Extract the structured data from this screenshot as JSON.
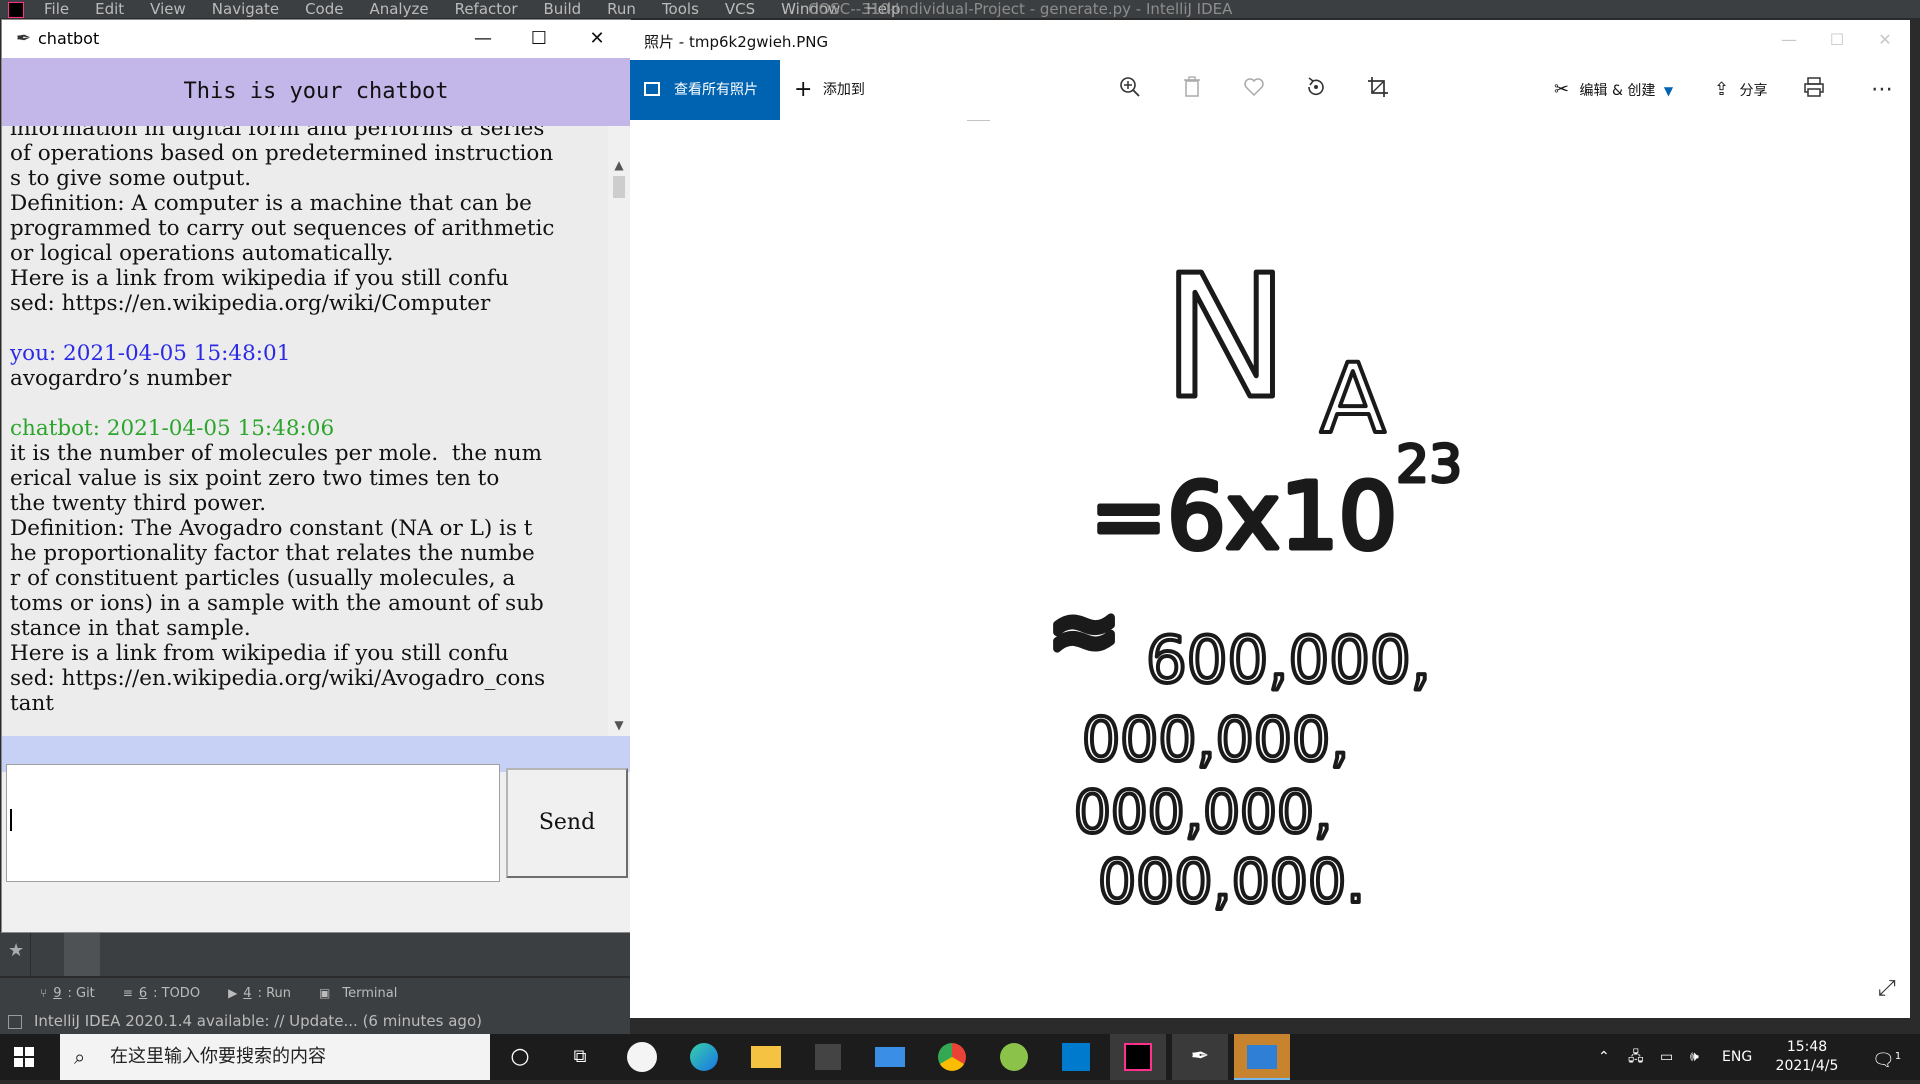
{
  "ide": {
    "menu": [
      "File",
      "Edit",
      "View",
      "Navigate",
      "Code",
      "Analyze",
      "Refactor",
      "Build",
      "Run",
      "Tools",
      "VCS",
      "Window",
      "Help"
    ],
    "title": "COSC--310-Individual-Project - generate.py - IntelliJ IDEA",
    "tool_windows": [
      {
        "key": "9",
        "label": ": Git",
        "icon": "git-branch-icon"
      },
      {
        "key": "6",
        "label": ": TODO",
        "icon": "list-icon"
      },
      {
        "key": "4",
        "label": ": Run",
        "icon": "run-icon"
      },
      {
        "key": "",
        "label": "Terminal",
        "icon": "terminal-icon"
      }
    ],
    "status": "IntelliJ IDEA 2020.1.4 available: // Update... (6 minutes ago)"
  },
  "chatbot": {
    "window_title": "chatbot",
    "header": "This is your chatbot",
    "send_label": "Send",
    "input_value": "",
    "log": [
      {
        "type": "text",
        "text": "information in digital form and performs a series"
      },
      {
        "type": "text",
        "text": "of operations based on predetermined instruction"
      },
      {
        "type": "text",
        "text": "s to give some output."
      },
      {
        "type": "text",
        "text": "Definition: A computer is a machine that can be"
      },
      {
        "type": "text",
        "text": "programmed to carry out sequences of arithmetic"
      },
      {
        "type": "text",
        "text": "or logical operations automatically."
      },
      {
        "type": "text",
        "text": "Here is a link from wikipedia if you still confu"
      },
      {
        "type": "text",
        "text": "sed: https://en.wikipedia.org/wiki/Computer"
      },
      {
        "type": "text",
        "text": " "
      },
      {
        "type": "you",
        "text": "you: 2021-04-05 15:48:01"
      },
      {
        "type": "text",
        "text": "avogardro’s number"
      },
      {
        "type": "text",
        "text": " "
      },
      {
        "type": "bot",
        "text": "chatbot: 2021-04-05 15:48:06"
      },
      {
        "type": "text",
        "text": "it is the number of molecules per mole.  the num"
      },
      {
        "type": "text",
        "text": "erical value is six point zero two times ten to"
      },
      {
        "type": "text",
        "text": "the twenty third power."
      },
      {
        "type": "text",
        "text": "Definition: The Avogadro constant (NA or L) is t"
      },
      {
        "type": "text",
        "text": "he proportionality factor that relates the numbe"
      },
      {
        "type": "text",
        "text": "r of constituent particles (usually molecules, a"
      },
      {
        "type": "text",
        "text": "toms or ions) in a sample with the amount of sub"
      },
      {
        "type": "text",
        "text": "stance in that sample."
      },
      {
        "type": "text",
        "text": "Here is a link from wikipedia if you still confu"
      },
      {
        "type": "text",
        "text": "sed: https://en.wikipedia.org/wiki/Avogadro_cons"
      },
      {
        "type": "text",
        "text": "tant"
      }
    ]
  },
  "photos": {
    "window_title": "照片 - tmp6k2gwieh.PNG",
    "view_all": "查看所有照片",
    "add_to": "添加到",
    "edit_create": "编辑 & 创建",
    "share": "分享",
    "image_text": {
      "symbol": "N",
      "subscript": "A",
      "equation": "=6x10",
      "exponent": "23",
      "approx": "≈",
      "line1": "600,000,",
      "line2": "000,000,",
      "line3": "000,000,",
      "line4": "000,000."
    }
  },
  "taskbar": {
    "search_placeholder": "在这里输入你要搜索的内容",
    "language": "ENG",
    "time": "15:48",
    "date": "2021/4/5",
    "notification_count": "1"
  }
}
